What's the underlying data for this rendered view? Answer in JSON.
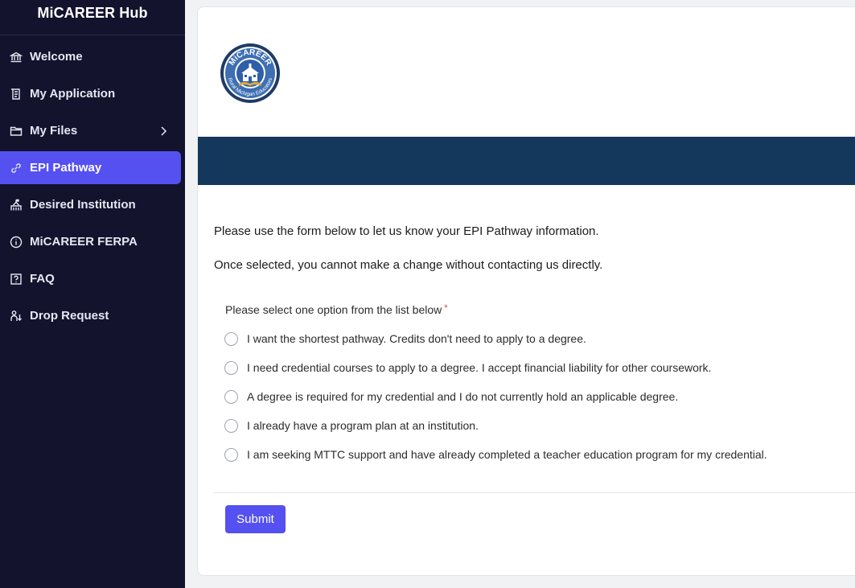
{
  "sidebar": {
    "brand": "MiCAREER Hub",
    "items": [
      {
        "label": "Welcome",
        "icon": "museum-icon"
      },
      {
        "label": "My Application",
        "icon": "document-icon"
      },
      {
        "label": "My Files",
        "icon": "folder-icon",
        "has_submenu": true
      },
      {
        "label": "EPI Pathway",
        "icon": "link-icon",
        "active": true
      },
      {
        "label": "Desired Institution",
        "icon": "institution-icon"
      },
      {
        "label": "MiCAREER FERPA",
        "icon": "info-icon"
      },
      {
        "label": "FAQ",
        "icon": "question-icon"
      },
      {
        "label": "Drop Request",
        "icon": "person-down-icon"
      }
    ],
    "active_color": "#5550f0",
    "background": "#13132e"
  },
  "main": {
    "logo": {
      "top_text": "MiCAREER",
      "bottom_text": "Rural Michigan Educators"
    },
    "banner_color": "#14375c",
    "intro_1": "Please use the form below to let us know your EPI Pathway information.",
    "intro_2": "Once selected, you cannot make a change without contacting us directly.",
    "question": "Please select one option from the list below",
    "required_mark": "*",
    "options": [
      "I want the shortest pathway. Credits don't need to apply to a degree.",
      "I need credential courses to apply to a degree. I accept financial liability for other coursework.",
      "A degree is required for my credential and I do not currently hold an applicable degree.",
      "I already have a program plan at an institution.",
      "I am seeking MTTC support and have already completed a teacher education program for my credential."
    ],
    "submit_label": "Submit"
  }
}
